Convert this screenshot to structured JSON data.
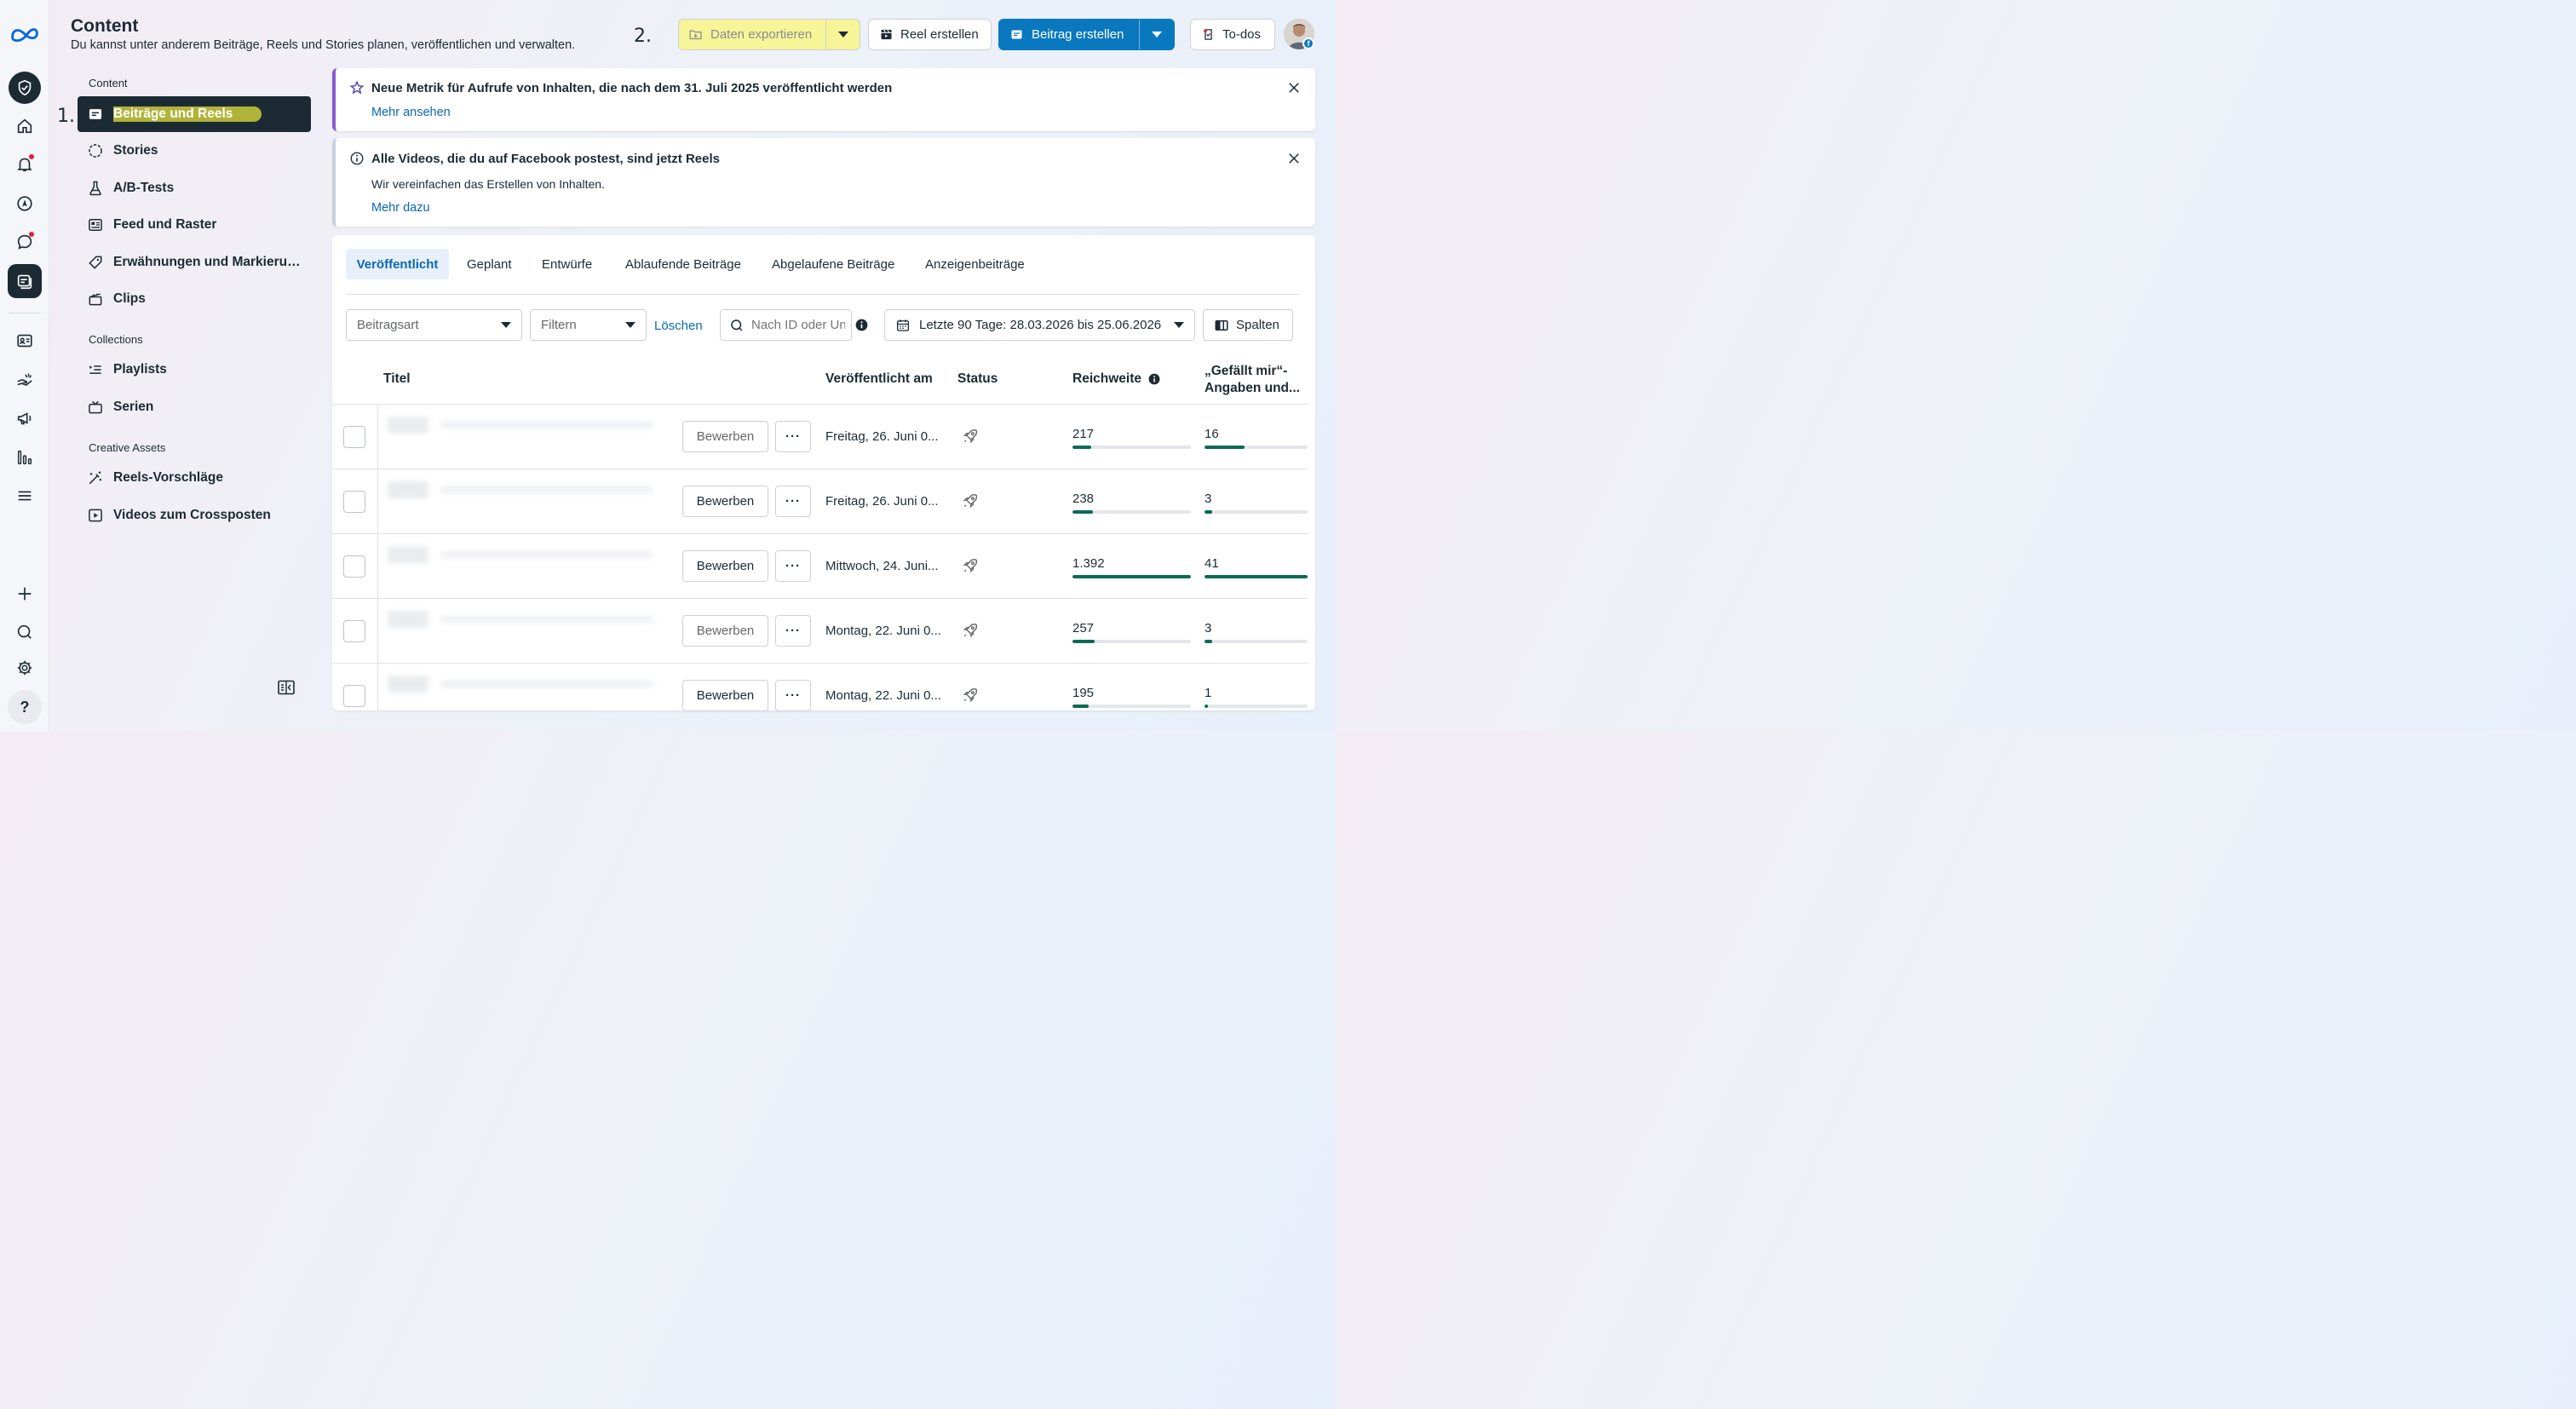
{
  "header": {
    "title": "Content",
    "subtitle": "Du kannst unter anderem Beiträge, Reels und Stories planen, veröffentlichen und verwalten.",
    "annotation_1": "1.",
    "annotation_2": "2.",
    "export_label": "Daten exportieren",
    "reel_label": "Reel erstellen",
    "post_label": "Beitrag erstellen",
    "todo_label": "To-dos"
  },
  "sidebar": {
    "section_content": "Content",
    "section_collections": "Collections",
    "section_creative": "Creative Assets",
    "items": [
      {
        "label": "Beiträge und Reels",
        "icon": "posts-icon"
      },
      {
        "label": "Stories",
        "icon": "stories-icon"
      },
      {
        "label": "A/B-Tests",
        "icon": "flask-icon"
      },
      {
        "label": "Feed und Raster",
        "icon": "feed-grid-icon"
      },
      {
        "label": "Erwähnungen und Markierungen",
        "icon": "tag-icon"
      },
      {
        "label": "Clips",
        "icon": "clapper-icon"
      },
      {
        "label": "Playlists",
        "icon": "playlist-icon"
      },
      {
        "label": "Serien",
        "icon": "tv-icon"
      },
      {
        "label": "Reels-Vorschläge",
        "icon": "magic-wand-icon"
      },
      {
        "label": "Videos zum Crossposten",
        "icon": "play-square-icon"
      }
    ]
  },
  "banners": [
    {
      "title": "Neue Metrik für Aufrufe von Inhalten, die nach dem 31. Juli 2025 veröffentlicht werden",
      "link": "Mehr ansehen"
    },
    {
      "title": "Alle Videos, die du auf Facebook postest, sind jetzt Reels",
      "text": "Wir vereinfachen das Erstellen von Inhalten.",
      "link": "Mehr dazu"
    }
  ],
  "tabs": [
    "Veröffentlicht",
    "Geplant",
    "Entwürfe",
    "Ablaufende Beiträge",
    "Abgelaufene Beiträge",
    "Anzeigenbeiträge"
  ],
  "filters": {
    "type_placeholder": "Beitragsart",
    "filter_placeholder": "Filtern",
    "clear": "Löschen",
    "search_placeholder": "Nach ID oder Untertitel suchen",
    "date_range": "Letzte 90 Tage: 28.03.2026 bis 25.06.2026",
    "columns": "Spalten"
  },
  "table": {
    "headers": {
      "title": "Titel",
      "published": "Veröffentlicht am",
      "status": "Status",
      "reach": "Reichweite",
      "likes": "„Gefällt mir“-Angaben und..."
    },
    "promote_label": "Bewerben",
    "rows": [
      {
        "date": "Freitag, 26. Juni 0...",
        "reach": "217",
        "reach_frac": 0.156,
        "likes": "16",
        "likes_frac": 0.39,
        "promote_enabled": false
      },
      {
        "date": "Freitag, 26. Juni 0...",
        "reach": "238",
        "reach_frac": 0.171,
        "likes": "3",
        "likes_frac": 0.073,
        "promote_enabled": true
      },
      {
        "date": "Mittwoch, 24. Juni...",
        "reach": "1.392",
        "reach_frac": 1.0,
        "likes": "41",
        "likes_frac": 1.0,
        "promote_enabled": true
      },
      {
        "date": "Montag, 22. Juni 0...",
        "reach": "257",
        "reach_frac": 0.185,
        "likes": "3",
        "likes_frac": 0.073,
        "promote_enabled": false
      },
      {
        "date": "Montag, 22. Juni 0...",
        "reach": "195",
        "reach_frac": 0.14,
        "likes": "1",
        "likes_frac": 0.024,
        "promote_enabled": true
      }
    ]
  },
  "colors": {
    "accent": "#0a78be",
    "highlight": "#f8f678",
    "bar": "#0b6b53",
    "banner_purple": "#8a5bd0"
  }
}
